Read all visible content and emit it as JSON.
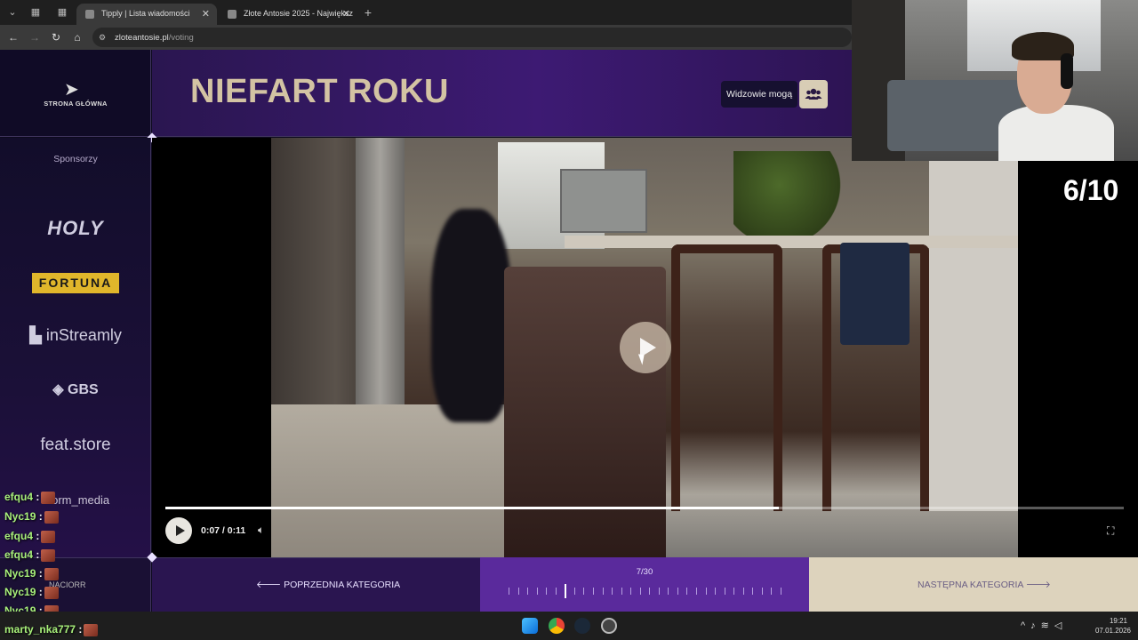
{
  "browser": {
    "tabs": [
      {
        "title": "Tipply | Lista wiadomości",
        "active": true
      },
      {
        "title": "Złote Antosie 2025 - Największ",
        "active": false
      }
    ],
    "new_tab_label": "+",
    "url_domain": "zloteantosie.pl",
    "url_path": "/voting"
  },
  "site": {
    "home_label": "STRONA GŁÓWNA",
    "category_title": "NIEFART ROKU",
    "viewers_label": "Widzowie mogą",
    "sponsors_label": "Sponsorzy",
    "sponsors": [
      "HOLY",
      "FORTUNA",
      "inStreamly",
      "GBS",
      "feat.store"
    ]
  },
  "video": {
    "current_time": "0:07",
    "duration": "0:11",
    "time_display": "0:07 / 0:11",
    "progress": 0.64
  },
  "score_overlay": "6/10",
  "bottom_nav": {
    "prev_label": "POPRZEDNIA KATEGORIA",
    "next_label": "NASTĘPNA KATEGORIA",
    "counter": "7/30",
    "current": 7,
    "total": 30,
    "left_label": "NACIORR"
  },
  "chat": {
    "overlay_name": "storm_media",
    "messages": [
      {
        "user": "efqu4",
        "text": ":"
      },
      {
        "user": "Nyc19",
        "text": ":"
      },
      {
        "user": "efqu4",
        "text": ":"
      },
      {
        "user": "efqu4",
        "text": ":"
      },
      {
        "user": "Nyc19",
        "text": ":"
      },
      {
        "user": "Nyc19",
        "text": ":"
      },
      {
        "user": "Nyc19",
        "text": ":"
      },
      {
        "user": "marty_nka777",
        "text": ":"
      }
    ]
  },
  "taskbar": {
    "time": "19:21",
    "date": "07.01.2026"
  },
  "colors": {
    "header_purple": "#3d1a73",
    "title_beige": "#d3c3a3",
    "middle_purple": "#5a2a9c",
    "next_beige": "#ddd3bd",
    "chat_user_green": "#a8f07a"
  }
}
